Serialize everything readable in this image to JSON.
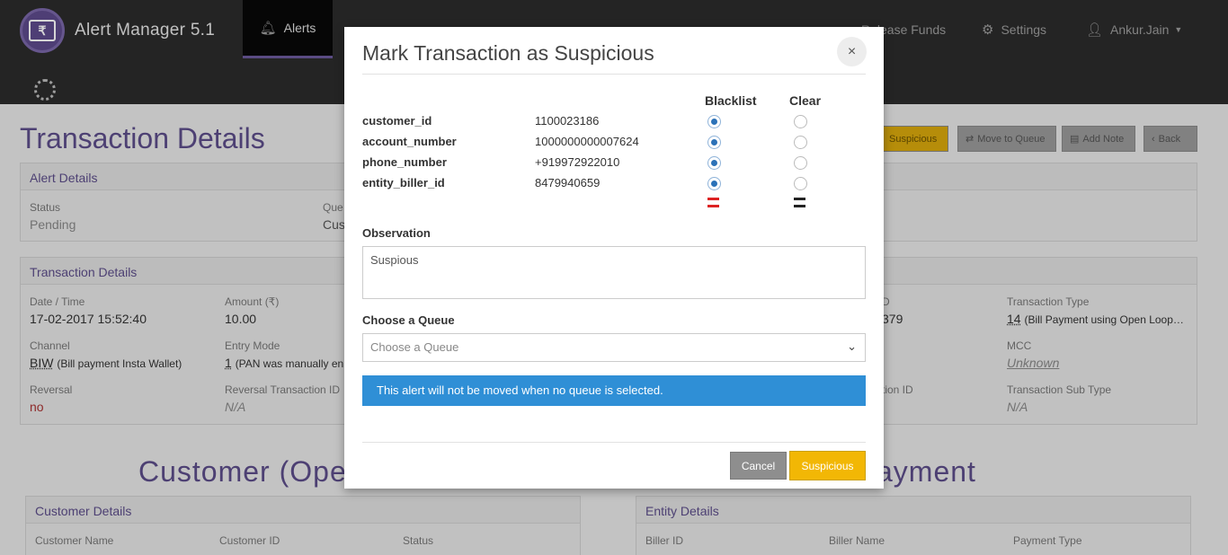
{
  "app": {
    "title": "Alert Manager 5.1",
    "logo_glyph": "₹"
  },
  "nav": {
    "items": [
      {
        "label": "Alerts"
      },
      {
        "label": "Release Funds"
      },
      {
        "label": "Settings"
      },
      {
        "label": "Ankur.Jain"
      }
    ]
  },
  "page": {
    "title": "Transaction Details",
    "buttons": {
      "suspicious": "Suspicious",
      "move_to_queue": "Move to Queue",
      "add_note": "Add Note",
      "back": "Back"
    },
    "alert_panel": {
      "heading": "Alert Details",
      "status_label": "Status",
      "status_value": "Pending",
      "queue_label": "Que",
      "queue_value": "Cus"
    },
    "txn_panel": {
      "heading": "Transaction Details",
      "datetime_label": "Date / Time",
      "datetime_value": "17-02-2017 15:52:40",
      "amount_label": "Amount (₹)",
      "amount_value": "10.00",
      "channel_label": "Channel",
      "channel_code": "BIW",
      "channel_desc": "(Bill payment Insta Wallet)",
      "entry_label": "Entry Mode",
      "entry_code": "1",
      "entry_desc": "(PAN was manually en",
      "reversal_label": "Reversal",
      "reversal_value": "no",
      "reversal_txn_label": "Reversal Transaction ID",
      "reversal_txn_value": "N/A",
      "right_col_frag": "D",
      "right_val_frag": "379",
      "txn_type_label": "Transaction Type",
      "txn_type_code": "14",
      "txn_type_desc": "(Bill Payment using Open Loop…",
      "mcc_label": "MCC",
      "mcc_value": "Unknown",
      "tid_frag": "tion ID",
      "txn_sub_label": "Transaction Sub Type",
      "txn_sub_value": "N/A"
    },
    "customer_title": "Customer (Ope",
    "payment_title": "ayment",
    "customer_panel": {
      "heading": "Customer Details",
      "name_label": "Customer Name",
      "id_label": "Customer ID",
      "status_label": "Status"
    },
    "entity_panel": {
      "heading": "Entity Details",
      "biller_id_label": "Biller ID",
      "biller_name_label": "Biller Name",
      "payment_type_label": "Payment Type"
    }
  },
  "modal": {
    "title": "Mark Transaction as Suspicious",
    "close_glyph": "×",
    "col_blacklist": "Blacklist",
    "col_clear": "Clear",
    "rows": [
      {
        "field": "customer_id",
        "value": "1100023186",
        "blacklist": true
      },
      {
        "field": "account_number",
        "value": "1000000000007624",
        "blacklist": true
      },
      {
        "field": "phone_number",
        "value": "+919972922010",
        "blacklist": true
      },
      {
        "field": "entity_biller_id",
        "value": "8479940659",
        "blacklist": true
      }
    ],
    "observation_label": "Observation",
    "observation_value": "Suspious",
    "queue_label": "Choose a Queue",
    "queue_placeholder": "Choose a Queue",
    "info_text": "This alert will not be moved when no queue is selected.",
    "cancel_label": "Cancel",
    "submit_label": "Suspicious"
  },
  "colors": {
    "brand_purple": "#5c4d8a",
    "info_blue": "#2f8fd6",
    "warning_yellow": "#f2b705",
    "cancel_grey": "#8e8e8e"
  }
}
